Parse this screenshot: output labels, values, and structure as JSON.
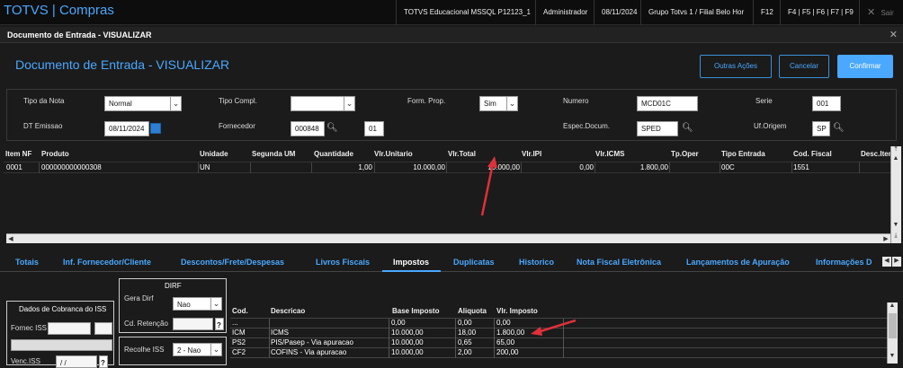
{
  "app": {
    "title": "TOTVS | Compras"
  },
  "topbar": {
    "env": "TOTVS Educacional MSSQL P12123_1",
    "user": "Administrador",
    "date": "08/11/2024",
    "branch": "Grupo Totvs 1 / Filial Belo Hor",
    "f12": "F12",
    "fkeys": "F4 | F5 | F6 | F7 | F9",
    "exit": "Sair"
  },
  "window": {
    "title": "Documento de Entrada - VISUALIZAR"
  },
  "header": {
    "title": "Documento de Entrada - VISUALIZAR",
    "btn_outras": "Outras Ações",
    "btn_cancelar": "Cancelar",
    "btn_confirmar": "Confirmar"
  },
  "form": {
    "tipo_nota_label": "Tipo da Nota",
    "tipo_nota_value": "Normal",
    "tipo_compl_label": "Tipo Compl.",
    "tipo_compl_value": "",
    "form_prop_label": "Form. Prop.",
    "form_prop_value": "Sim",
    "numero_label": "Numero",
    "numero_value": "MCD01C",
    "serie_label": "Serie",
    "serie_value": "001",
    "dt_emissao_label": "DT Emissao",
    "dt_emissao_value": "08/11/2024",
    "fornecedor_label": "Fornecedor",
    "fornecedor_value": "000848",
    "loja_value": "01",
    "espec_label": "Espec.Docum.",
    "espec_value": "SPED",
    "uf_label": "Uf.Origem",
    "uf_value": "SP"
  },
  "items_grid": {
    "headers": [
      "Item NF",
      "Produto",
      "Unidade",
      "Segunda UM",
      "Quantidade",
      "Vlr.Unitario",
      "Vlr.Total",
      "Vlr.IPI",
      "Vlr.ICMS",
      "Tp.Oper",
      "Tipo Entrada",
      "Cod. Fiscal",
      "Desc.Iten"
    ],
    "row": [
      "0001",
      "000000000000308",
      "UN",
      "",
      "1,00",
      "10.000,00",
      "10.000,00",
      "0,00",
      "1.800,00",
      "",
      "00C",
      "1551",
      ""
    ]
  },
  "tabs": [
    "Totais",
    "Inf. Fornecedor/Cliente",
    "Descontos/Frete/Despesas",
    "Livros Fiscais",
    "Impostos",
    "Duplicatas",
    "Historico",
    "Nota Fiscal Eletrônica",
    "Lançamentos de Apuração",
    "Informações D"
  ],
  "iss": {
    "title": "Dados de Cobranca do ISS",
    "fornec_label": "Fornec ISS",
    "venc_label": "Venc.ISS",
    "venc_value": " / /"
  },
  "dirf": {
    "title": "DIRF",
    "gera_label": "Gera Dirf",
    "gera_value": "Nao",
    "cd_label": "Cd. Retenção",
    "recolhe_label": "Recolhe ISS",
    "recolhe_value": "2 - Nao"
  },
  "tax_grid": {
    "headers": [
      "Cod.",
      "Descricao",
      "Base Imposto",
      "Aliquota",
      "Vlr. Imposto"
    ],
    "rows": [
      [
        "...",
        "",
        "0,00",
        "0,00",
        "0,00"
      ],
      [
        "ICM",
        "ICMS",
        "10.000,00",
        "18,00",
        "1.800,00"
      ],
      [
        "PS2",
        "PIS/Pasep - Via apuracao",
        "10.000,00",
        "0,65",
        "65,00"
      ],
      [
        "CF2",
        "COFINS - Via apuracao",
        "10.000,00",
        "2,00",
        "200,00"
      ]
    ]
  },
  "colors": {
    "accent": "#4aa8ff",
    "arrow": "#e0303a",
    "background": "#1b1b1b"
  }
}
